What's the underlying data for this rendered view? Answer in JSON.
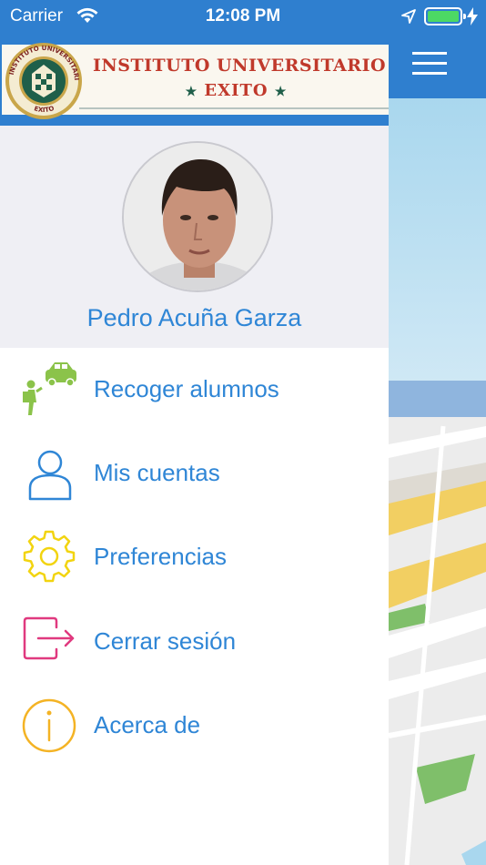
{
  "status_bar": {
    "carrier": "Carrier",
    "time": "12:08 PM",
    "battery_level": 1.0
  },
  "banner": {
    "title_line1": "INSTITUTO UNIVERSITARIO",
    "title_line2": "EXITO",
    "logo_text": "INSTITUTO UNIVERSITARIO EXITO"
  },
  "profile": {
    "name": "Pedro Acuña Garza"
  },
  "menu": {
    "items": [
      {
        "label": "Recoger alumnos",
        "icon": "pickup-students-icon",
        "color": "#8bc34a"
      },
      {
        "label": "Mis cuentas",
        "icon": "user-account-icon",
        "color": "#2f86d6"
      },
      {
        "label": "Preferencias",
        "icon": "gear-icon",
        "color": "#f2d40f"
      },
      {
        "label": "Cerrar sesión",
        "icon": "logout-icon",
        "color": "#e0397f"
      },
      {
        "label": "Acerca de",
        "icon": "info-icon",
        "color": "#f4b324"
      }
    ]
  },
  "colors": {
    "header_blue": "#2f7fcf",
    "label_blue": "#2f86d6"
  }
}
